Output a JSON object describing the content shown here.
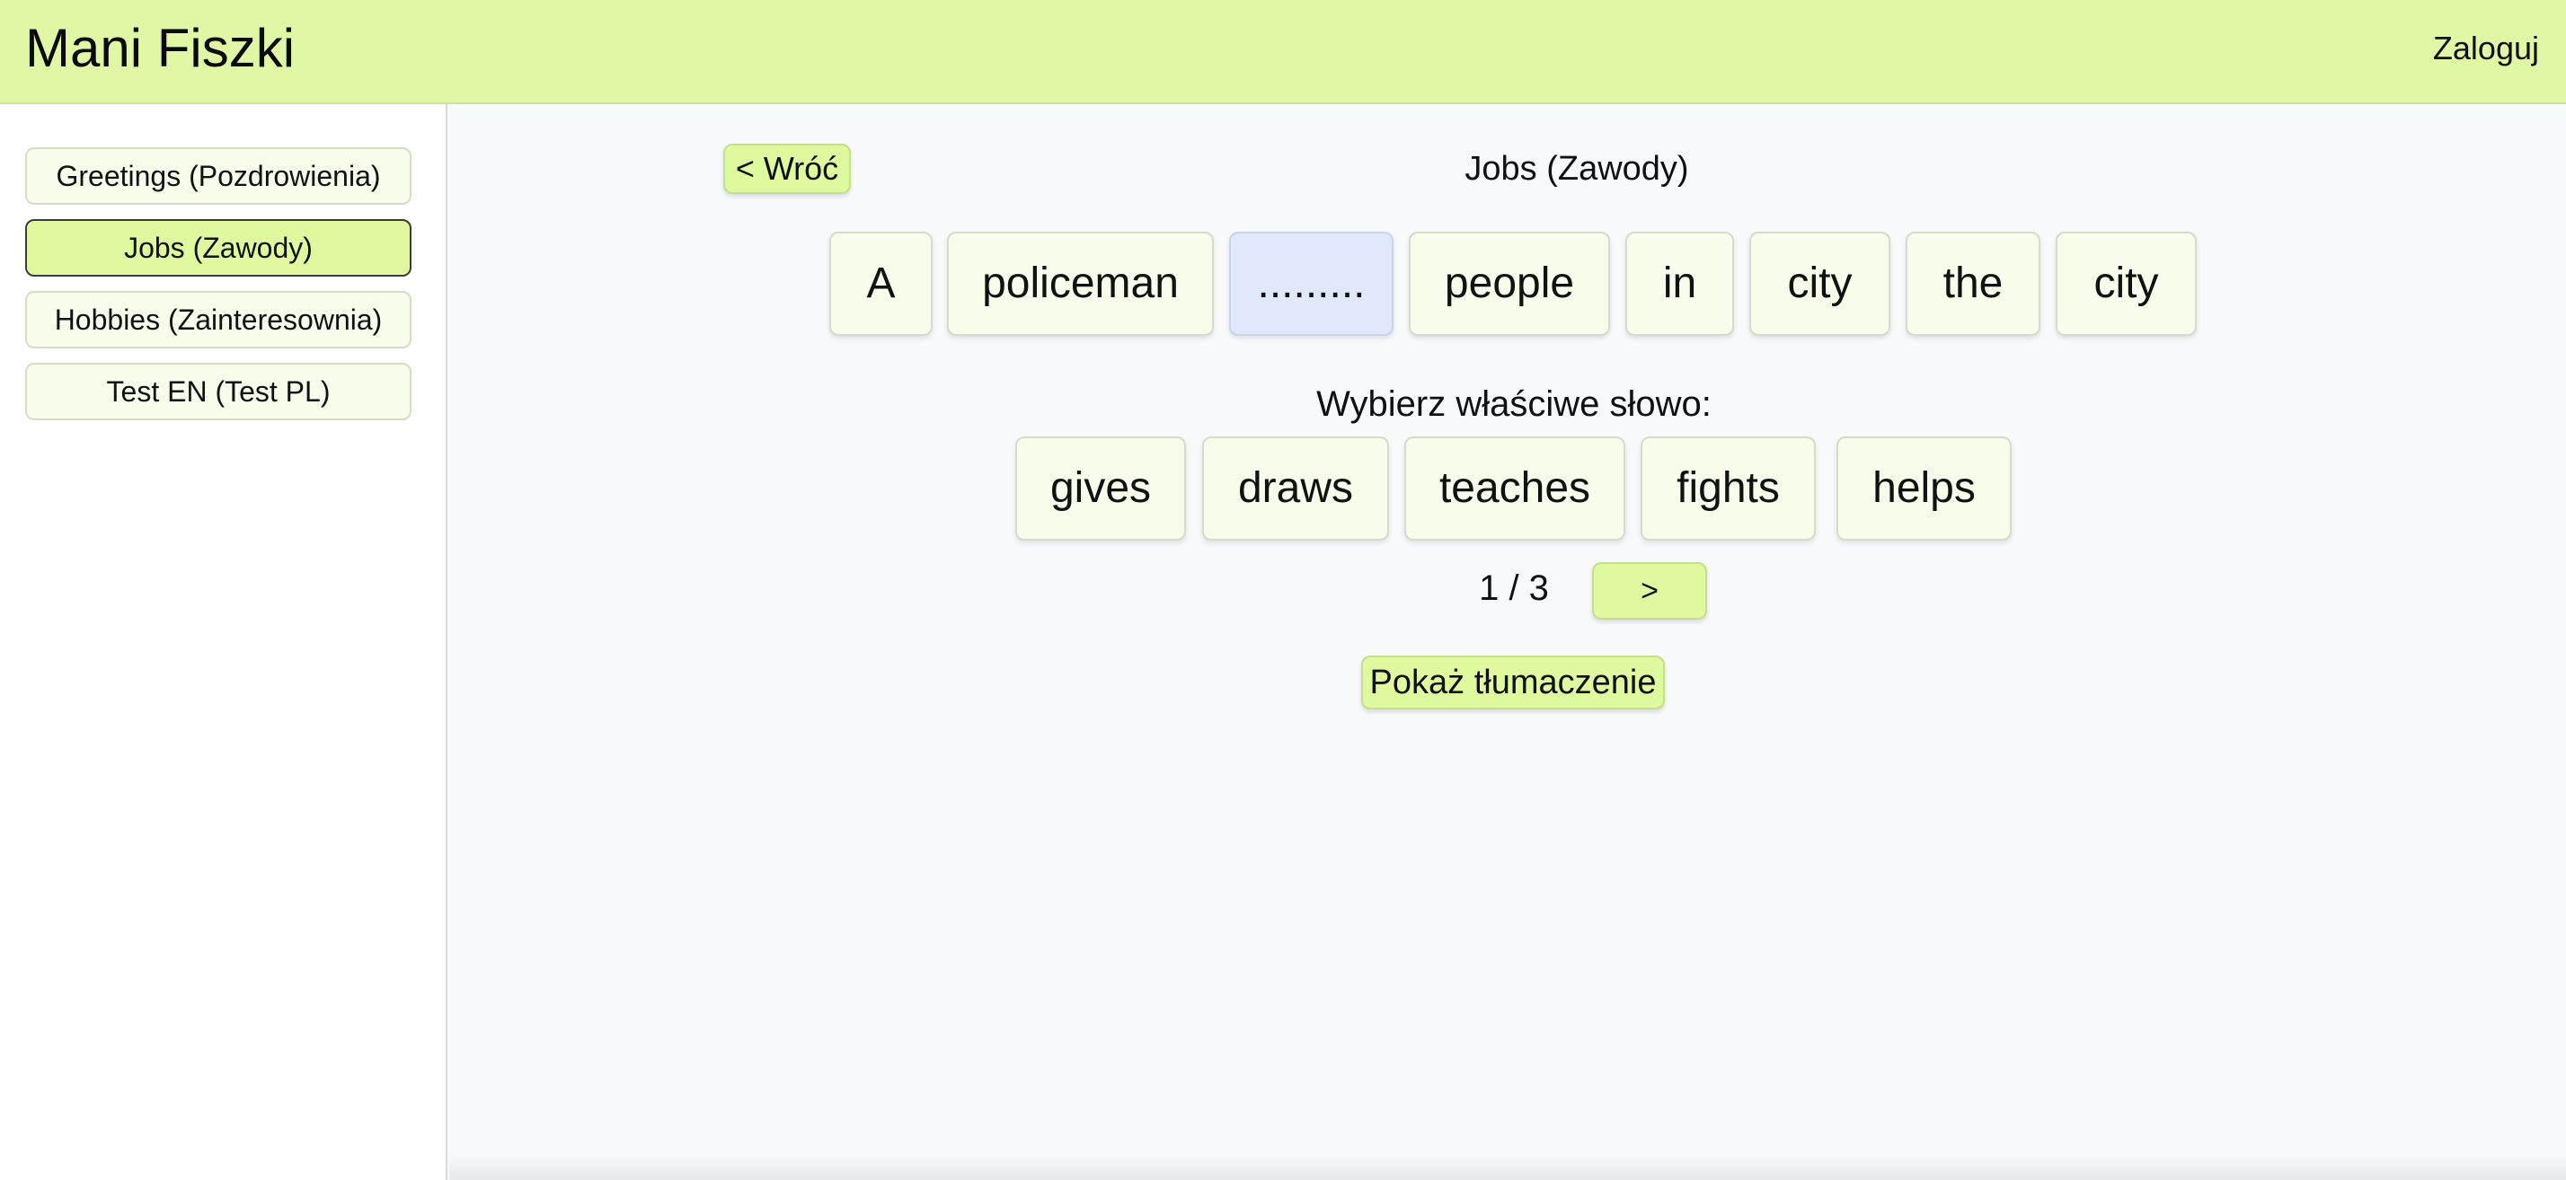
{
  "header": {
    "app_title": "Mani Fiszki",
    "login_label": "Zaloguj"
  },
  "sidebar": {
    "items": [
      {
        "label": "Greetings (Pozdrowienia)",
        "active": false
      },
      {
        "label": "Jobs (Zawody)",
        "active": true
      },
      {
        "label": "Hobbies (Zainteresownia)",
        "active": false
      },
      {
        "label": "Test EN (Test PL)",
        "active": false
      }
    ]
  },
  "main": {
    "back_label": "< Wróć",
    "title": "Jobs (Zawody)",
    "sentence_words": [
      "A",
      "policeman",
      ".........",
      "people",
      "in",
      "city",
      "the",
      "city"
    ],
    "blank_index": 2,
    "prompt": "Wybierz właściwe słowo:",
    "choices": [
      "gives",
      "draws",
      "teaches",
      "fights",
      "helps"
    ],
    "progress": "1 / 3",
    "next_label": ">",
    "translate_label": "Pokaż tłumaczenie"
  },
  "colors": {
    "header_bg": "#e0f8a6",
    "accent_button": "#def99e",
    "tile_bg": "#f8fcea",
    "blank_tile_bg": "#dfe9fb",
    "page_bg": "#f8f9fb"
  }
}
